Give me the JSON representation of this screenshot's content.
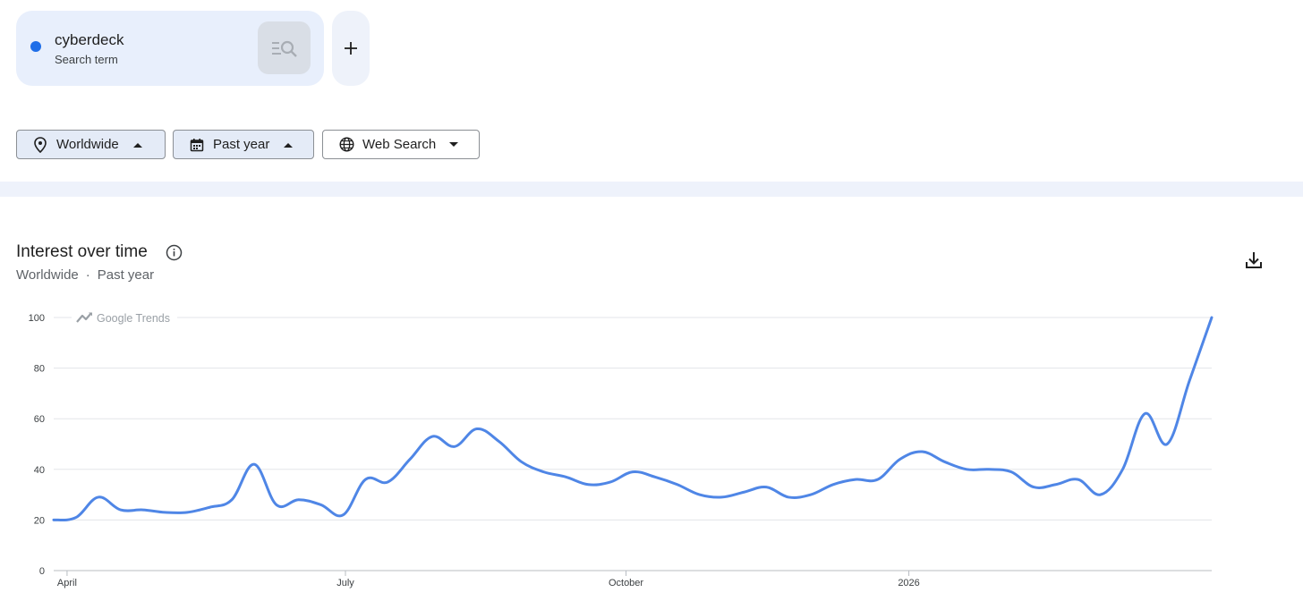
{
  "search_term": {
    "name": "cyberdeck",
    "type": "Search term",
    "dot_color": "#1f6ee8"
  },
  "filters": {
    "region": "Worldwide",
    "period": "Past year",
    "property": "Web Search"
  },
  "chart_header": {
    "title": "Interest over time",
    "sub_region": "Worldwide",
    "separator": "·",
    "sub_period": "Past year"
  },
  "watermark": "Google Trends",
  "chart_data": {
    "type": "line",
    "title": "Interest over time",
    "ylim": [
      0,
      100
    ],
    "y_ticks": [
      "0",
      "20",
      "40",
      "60",
      "80",
      "100"
    ],
    "x_ticks": [
      {
        "label": "April",
        "index": 0.6
      },
      {
        "label": "July",
        "index": 13.1
      },
      {
        "label": "October",
        "index": 25.7
      },
      {
        "label": "2026",
        "index": 38.4
      }
    ],
    "grid": true,
    "line_color": "#4f86e6",
    "series": [
      {
        "values": [
          20,
          21,
          29,
          24,
          24,
          23,
          23,
          25,
          28,
          42,
          26,
          28,
          26,
          22,
          36,
          35,
          44,
          53,
          49,
          56,
          51,
          43,
          39,
          37,
          34,
          35,
          39,
          37,
          34,
          30,
          29,
          31,
          33,
          29,
          30,
          34,
          36,
          36,
          44,
          47,
          43,
          40,
          40,
          39,
          33,
          34,
          36,
          30,
          40,
          62,
          50,
          75,
          100
        ]
      }
    ]
  }
}
